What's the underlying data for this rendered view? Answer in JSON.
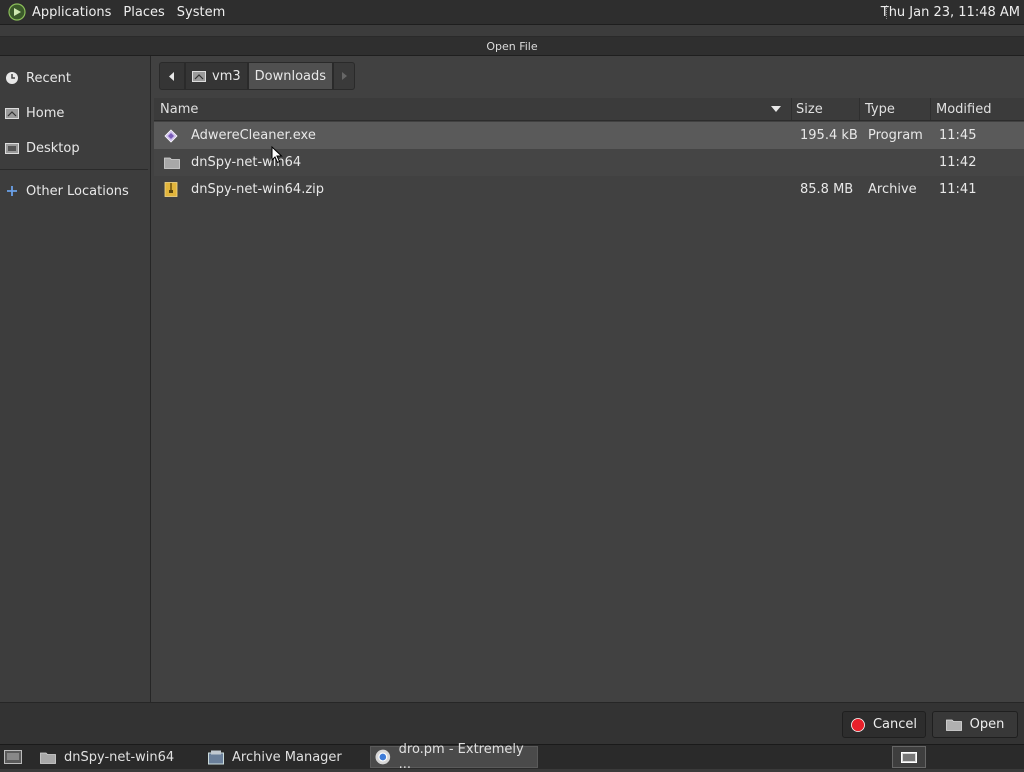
{
  "top_panel": {
    "menus": [
      "Applications",
      "Places",
      "System"
    ],
    "clock": "Thu Jan 23, 11:48 AM"
  },
  "dialog": {
    "title": "Open File"
  },
  "sidebar": {
    "items": [
      {
        "label": "Recent",
        "icon": "recent-icon"
      },
      {
        "label": "Home",
        "icon": "home-icon"
      },
      {
        "label": "Desktop",
        "icon": "desktop-icon"
      },
      {
        "label": "Other Locations",
        "icon": "other-locations-icon"
      }
    ]
  },
  "pathbar": {
    "segments": [
      "vm3",
      "Downloads"
    ]
  },
  "columns": {
    "name": "Name",
    "size": "Size",
    "type": "Type",
    "modified": "Modified"
  },
  "files": [
    {
      "name": "AdwereCleaner.exe",
      "size": "195.4 kB",
      "type": "Program",
      "modified": "11:45",
      "icon": "executable-icon"
    },
    {
      "name": "dnSpy-net-win64",
      "size": "",
      "type": "",
      "modified": "11:42",
      "icon": "folder-icon"
    },
    {
      "name": "dnSpy-net-win64.zip",
      "size": "85.8 MB",
      "type": "Archive",
      "modified": "11:41",
      "icon": "archive-icon"
    }
  ],
  "buttons": {
    "cancel": "Cancel",
    "open": "Open"
  },
  "taskbar": {
    "items": [
      "dnSpy-net-win64",
      "Archive Manager",
      "dro.pm - Extremely ..."
    ]
  },
  "colors": {
    "selection": "#5a5a5a",
    "cancel_icon": "#e8202a"
  }
}
